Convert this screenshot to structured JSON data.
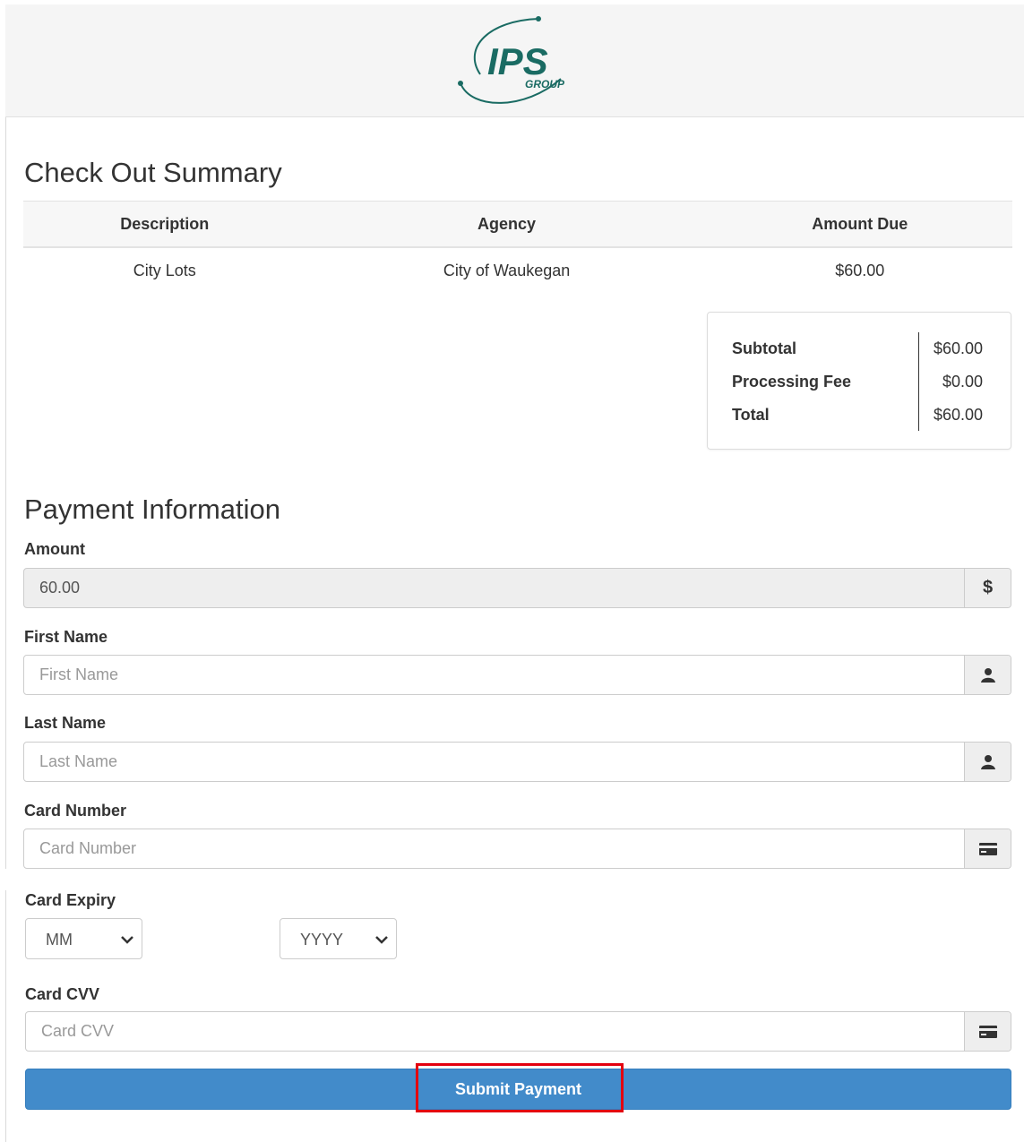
{
  "brand": {
    "logo_text": "IPS",
    "logo_subtext": "GROUP",
    "logo_color": "#1a6b63"
  },
  "summary": {
    "title": "Check Out Summary",
    "columns": [
      "Description",
      "Agency",
      "Amount Due"
    ],
    "rows": [
      {
        "description": "City Lots",
        "agency": "City of Waukegan",
        "amount_due": "$60.00"
      }
    ],
    "totals": [
      {
        "label": "Subtotal",
        "value": "$60.00"
      },
      {
        "label": "Processing Fee",
        "value": "$0.00"
      },
      {
        "label": "Total",
        "value": "$60.00"
      }
    ]
  },
  "payment": {
    "title": "Payment Information",
    "amount": {
      "label": "Amount",
      "value": "60.00",
      "addon": "$"
    },
    "first_name": {
      "label": "First Name",
      "placeholder": "First Name",
      "icon": "user-icon"
    },
    "last_name": {
      "label": "Last Name",
      "placeholder": "Last Name",
      "icon": "user-icon"
    },
    "card_number": {
      "label": "Card Number",
      "placeholder": "Card Number",
      "icon": "credit-card-icon"
    },
    "card_expiry": {
      "label": "Card Expiry",
      "month": "MM",
      "year": "YYYY"
    },
    "card_cvv": {
      "label": "Card CVV",
      "placeholder": "Card CVV",
      "icon": "credit-card-icon"
    },
    "submit_label": "Submit Payment"
  },
  "colors": {
    "primary": "#428bca",
    "highlight": "#e3000f"
  }
}
